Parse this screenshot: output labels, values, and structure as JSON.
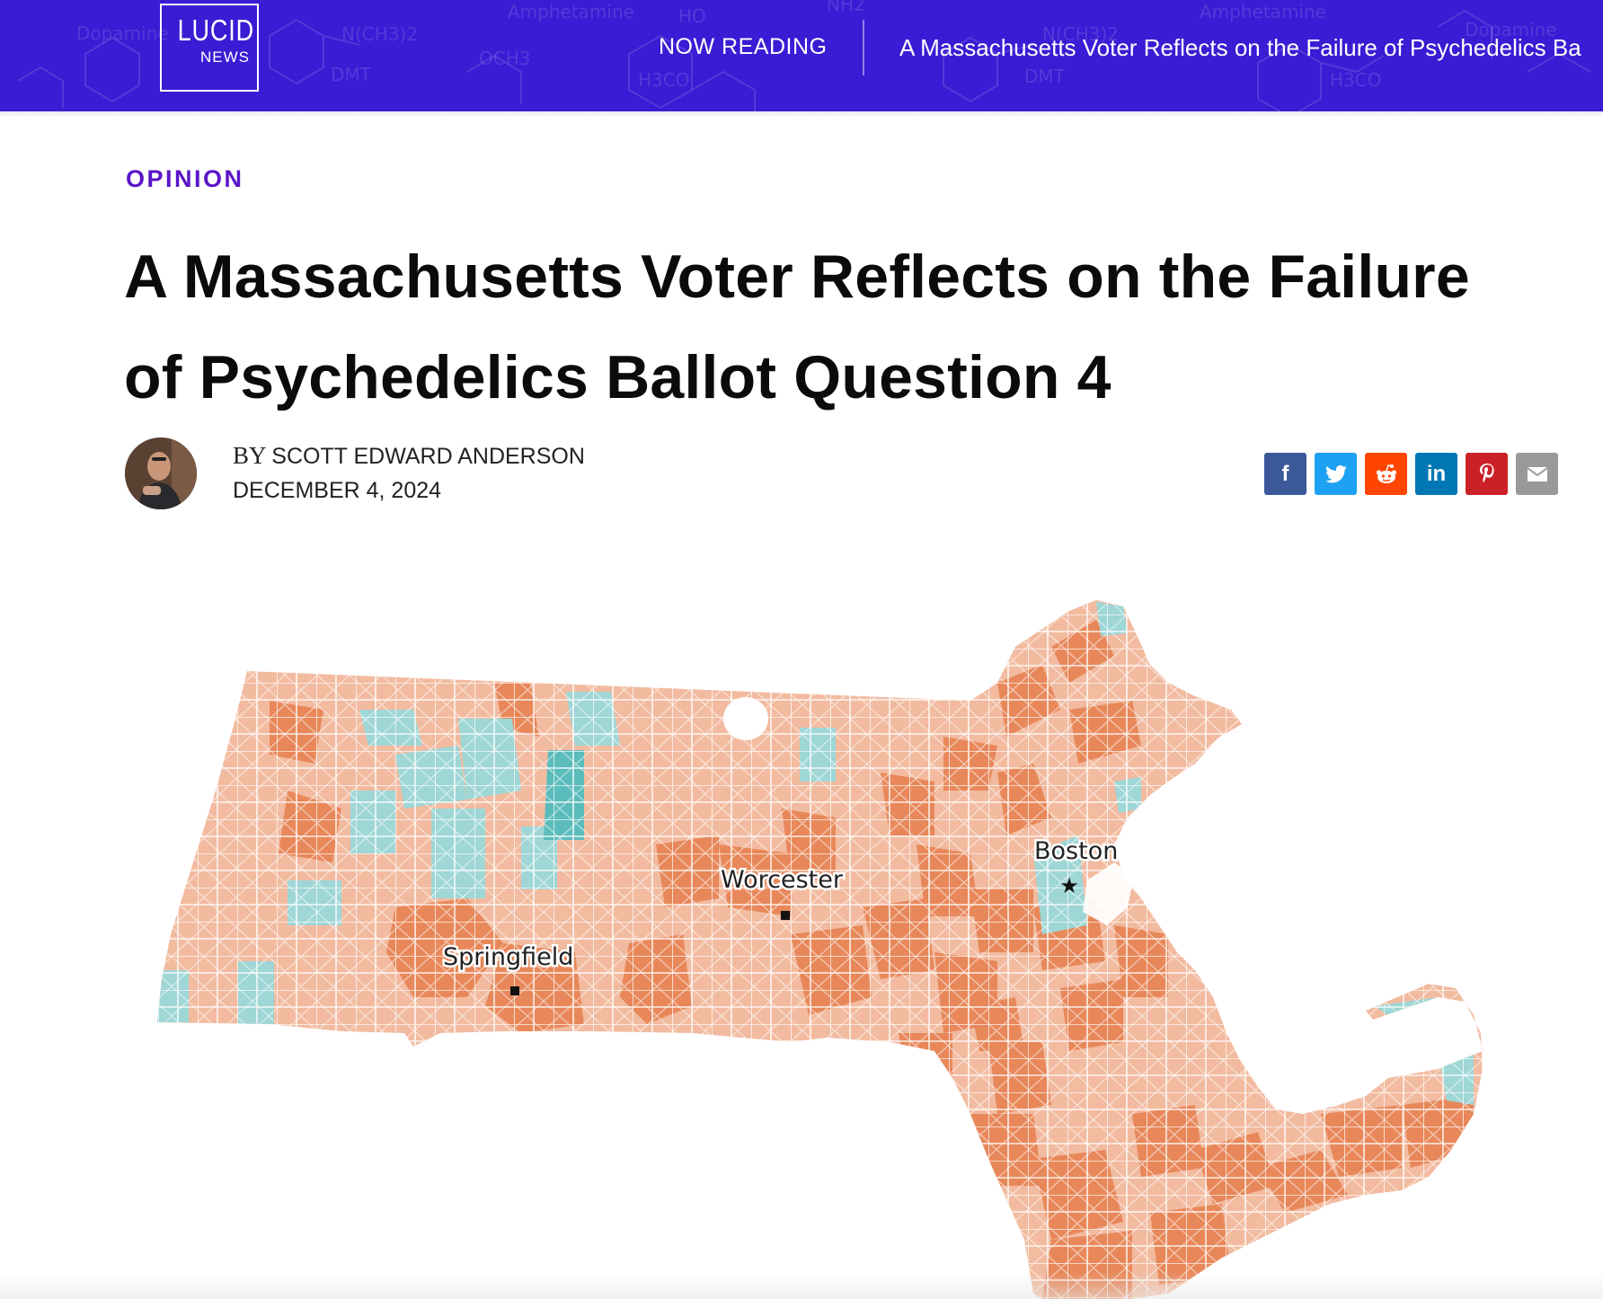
{
  "header": {
    "logo_main": "LUCID",
    "logo_sub": "NEWS",
    "now_reading_label": "NOW READING",
    "now_reading_title": "A Massachusetts Voter Reflects on the Failure of Psychedelics Ba",
    "background_color": "#3b1bd4",
    "watermark_words": [
      "Dopamine",
      "Amphetamine",
      "HO",
      "NH2",
      "N(CH3)2",
      "OCH3",
      "H3CO",
      "DMT",
      "N"
    ]
  },
  "article": {
    "category": "OPINION",
    "title": "A Massachusetts Voter Reflects on the Failure of Psychedelics Ballot Question 4",
    "byline_prefix": "BY",
    "author": "SCOTT EDWARD ANDERSON",
    "date": "DECEMBER 4, 2024"
  },
  "share_buttons": [
    {
      "name": "facebook",
      "glyph": "f",
      "color": "#3b5998"
    },
    {
      "name": "twitter",
      "glyph": "🐦",
      "color": "#1da1f2"
    },
    {
      "name": "reddit",
      "glyph": "👽",
      "color": "#ff4500"
    },
    {
      "name": "linkedin",
      "glyph": "in",
      "color": "#0077b5"
    },
    {
      "name": "pinterest",
      "glyph": "P",
      "color": "#cb2027"
    },
    {
      "name": "email",
      "glyph": "✉",
      "color": "#999999"
    }
  ],
  "map": {
    "cities": [
      {
        "label": "Worcester"
      },
      {
        "label": "Springfield"
      },
      {
        "label": "Boston"
      }
    ],
    "colors": {
      "strong_no": "#e8885a",
      "lean_no": "#f2bba0",
      "lean_yes": "#9fd6d6",
      "strong_yes": "#5bbcbc"
    }
  }
}
